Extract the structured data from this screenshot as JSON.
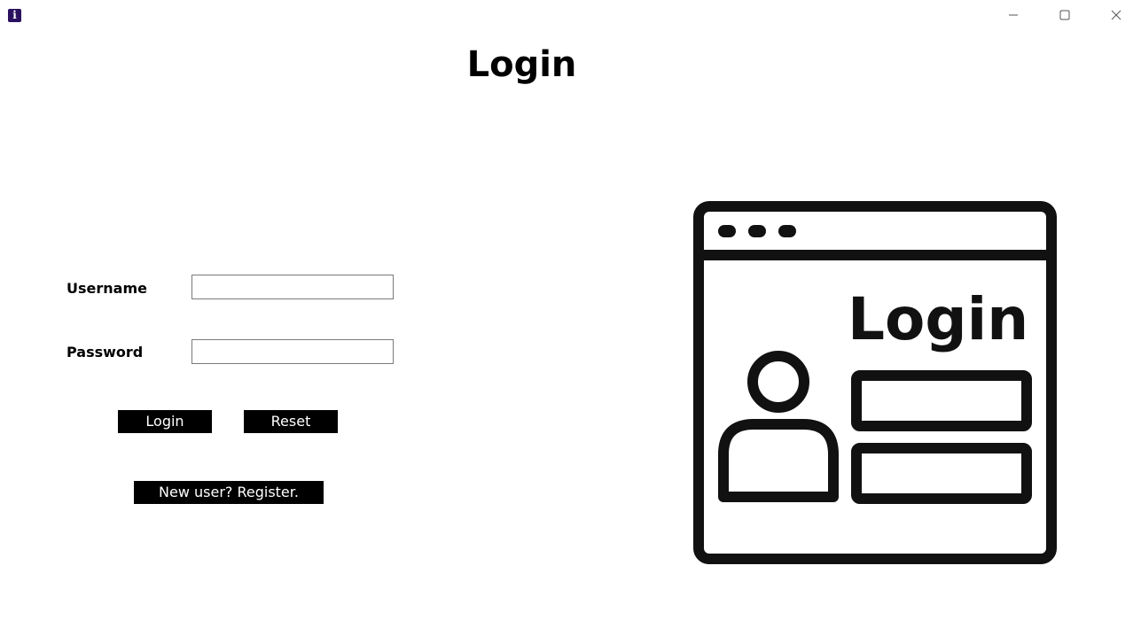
{
  "window": {
    "app_icon_letter": "i",
    "controls": {
      "minimize": "minimize-icon",
      "maximize": "maximize-icon",
      "close": "close-icon"
    }
  },
  "page": {
    "title": "Login"
  },
  "form": {
    "username_label": "Username",
    "username_value": "",
    "password_label": "Password",
    "password_value": ""
  },
  "buttons": {
    "login_label": "Login",
    "reset_label": "Reset",
    "register_label": "New user? Register."
  },
  "illustration": {
    "icon": "login-window-illustration",
    "text": "Login"
  },
  "colors": {
    "app_icon_bg": "#2a1160",
    "button_bg": "#000000",
    "button_text": "#ffffff",
    "illustration_stroke": "#111111"
  }
}
